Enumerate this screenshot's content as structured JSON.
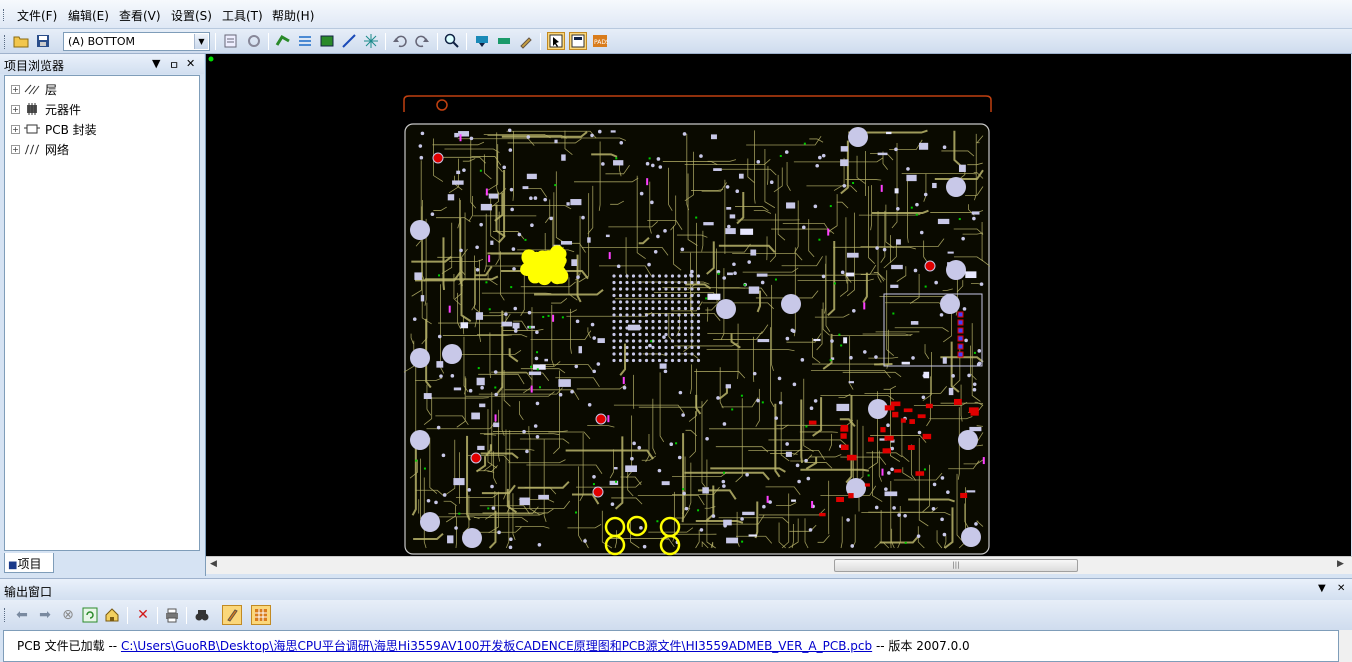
{
  "menu": {
    "items": [
      {
        "label": "文件(F)"
      },
      {
        "label": "编辑(E)"
      },
      {
        "label": "查看(V)"
      },
      {
        "label": "设置(S)"
      },
      {
        "label": "工具(T)"
      },
      {
        "label": "帮助(H)"
      }
    ]
  },
  "toolbar": {
    "layer_selected": "(A) BOTTOM",
    "icons": [
      "open-folder-icon",
      "save-icon",
      "properties-icon",
      "refresh-icon",
      "route-icon",
      "bus-icon",
      "board-icon",
      "line-icon",
      "ratsnest-icon",
      "undo-icon",
      "redo-icon",
      "zoom-icon",
      "highlight-icon",
      "unroute-icon",
      "clear-icon",
      "select-mode-icon",
      "window-icon",
      "pads-icon"
    ]
  },
  "project_panel": {
    "title": "项目浏览器",
    "tree": [
      {
        "label": "层",
        "icon": "layers-icon"
      },
      {
        "label": "元器件",
        "icon": "component-icon"
      },
      {
        "label": "PCB 封装",
        "icon": "footprint-icon"
      },
      {
        "label": "网络",
        "icon": "net-icon"
      }
    ],
    "tab_label": "项目"
  },
  "output_panel": {
    "title": "输出窗口",
    "message_prefix": "PCB 文件已加载  -- ",
    "message_path": "C:\\Users\\GuoRB\\Desktop\\海思CPU平台调研\\海思Hi3559AV100开发板CADENCE原理图和PCB源文件\\HI3559ADMEB_VER_A_PCB.pcb",
    "message_suffix": " -- 版本  2007.0.0"
  },
  "colors": {
    "canvas_bg": "#000000",
    "trace": "#b8b46a",
    "board_outline": "#c8c8c8",
    "pad": "#c8c8e8",
    "component": "#e8e8ff",
    "highlight": "#ffff00",
    "red_part": "#e00000",
    "green_via": "#00cc00",
    "magenta": "#ff40ff",
    "top_rail": "#c04010",
    "accent": "#fbd77a"
  }
}
